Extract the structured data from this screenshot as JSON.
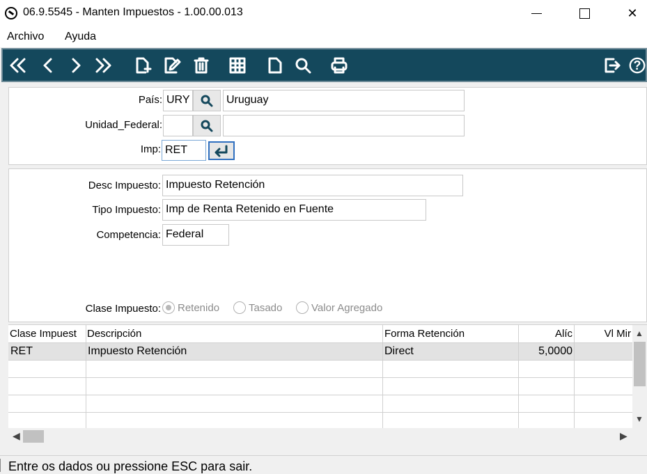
{
  "window": {
    "title": "06.9.5545 - Manten Impuestos - 1.00.00.013",
    "minimize_label": "",
    "maximize_label": "",
    "close_label": "✕"
  },
  "menu": [
    "Archivo",
    "Ayuda"
  ],
  "toolbar": {
    "buttons": [
      "first-icon",
      "previous-icon",
      "next-icon",
      "last-icon",
      "new-record-icon",
      "edit-icon",
      "delete-icon",
      "grid-icon",
      "blank-document-icon",
      "search-icon",
      "print-icon",
      "exit-icon",
      "help-icon"
    ],
    "help_label": "?"
  },
  "header_form": {
    "pais_label": "País:",
    "pais_code": "URY",
    "pais_name": "Uruguay",
    "unidad_federal_label": "Unidad_Federal:",
    "unidad_federal_code": "",
    "unidad_federal_name": "",
    "imp_label": "Imp:",
    "imp_value": "RET"
  },
  "detail_form": {
    "desc_label": "Desc Impuesto:",
    "desc_value": "Impuesto Retención",
    "tipo_label": "Tipo Impuesto:",
    "tipo_value": "Imp de Renta Retenido en Fuente",
    "competencia_label": "Competencia:",
    "competencia_value": "Federal",
    "clase_label": "Clase Impuesto:",
    "clase_options": [
      "Retenido",
      "Tasado",
      "Valor Agregado"
    ],
    "clase_selected": "Retenido"
  },
  "grid": {
    "columns": [
      "Clase Impuest",
      "Descripción",
      "Forma Retención",
      "Alíc",
      "Vl Mir"
    ],
    "rows": [
      [
        "RET",
        "Impuesto Retención",
        "Direct",
        "5,0000",
        ""
      ]
    ]
  },
  "statusbar": {
    "message": "Entre os dados ou pressione ESC para sair."
  }
}
